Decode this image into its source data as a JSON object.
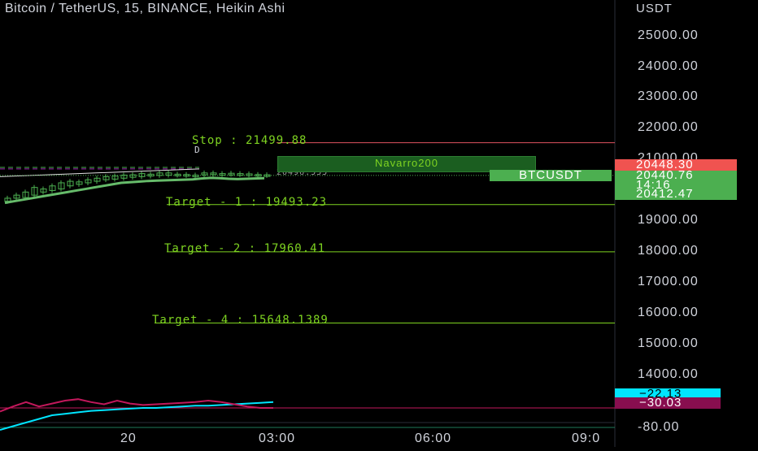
{
  "header": {
    "title": "Bitcoin / TetherUS, 15, BINANCE, Heikin Ashi",
    "currency": "USDT"
  },
  "price_axis_ticks": [
    "25000.00",
    "24000.00",
    "23000.00",
    "22000.00",
    "21000.00",
    "19000.00",
    "18000.00",
    "17000.00",
    "16000.00",
    "15000.00",
    "14000.00"
  ],
  "indicator_axis_ticks": [
    "-80.00"
  ],
  "time_axis_ticks": [
    "20",
    "03:00",
    "06:00",
    "09:0"
  ],
  "levels": {
    "stop": {
      "label": "Stop : 21499.88",
      "value": 21499.88,
      "color": "#e05260"
    },
    "target1": {
      "label": "Target - 1 : 19493.23",
      "value": 19493.23,
      "color": "#7ed321"
    },
    "target2": {
      "label": "Target - 2 : 17960.41",
      "value": 17960.41,
      "color": "#7ed321"
    },
    "target4": {
      "label": "Target - 4 : 15648.1389",
      "value": 15648.1389,
      "color": "#7ed321"
    },
    "entry_fragment": "20496.555",
    "d_marker": "D"
  },
  "overlays": {
    "navarro_box": "Navarro200",
    "symbol_tag": "BTCUSDT"
  },
  "price_tags": {
    "high": {
      "value": "20448.30",
      "color": "#f05350"
    },
    "last": {
      "value": "20440.76",
      "countdown": "14:16",
      "color": "#4caf50"
    },
    "low": {
      "value": "20412.47",
      "color": "#4caf50"
    }
  },
  "indicator_tags": {
    "cyan": {
      "value": "−22.13",
      "bg": "#00e5ff",
      "fg": "#000"
    },
    "maroon": {
      "value": "−30.03",
      "bg": "#880e4f",
      "fg": "#fff"
    }
  },
  "chart_data": {
    "type": "line",
    "title": "Bitcoin / TetherUS, 15, BINANCE, Heikin Ashi",
    "y_unit": "USDT",
    "ylim": [
      13600,
      25600
    ],
    "candles_ha": [
      {
        "o": 19600,
        "c": 19700
      },
      {
        "o": 19700,
        "c": 19800
      },
      {
        "o": 19720,
        "c": 19900
      },
      {
        "o": 19800,
        "c": 20050
      },
      {
        "o": 19900,
        "c": 20000
      },
      {
        "o": 19950,
        "c": 20100
      },
      {
        "o": 20000,
        "c": 20200
      },
      {
        "o": 20100,
        "c": 20250
      },
      {
        "o": 20150,
        "c": 20230
      },
      {
        "o": 20200,
        "c": 20300
      },
      {
        "o": 20250,
        "c": 20350
      },
      {
        "o": 20300,
        "c": 20400
      },
      {
        "o": 20320,
        "c": 20420
      },
      {
        "o": 20350,
        "c": 20450
      },
      {
        "o": 20380,
        "c": 20460
      },
      {
        "o": 20400,
        "c": 20500
      },
      {
        "o": 20420,
        "c": 20480
      },
      {
        "o": 20440,
        "c": 20520
      },
      {
        "o": 20450,
        "c": 20520
      },
      {
        "o": 20450,
        "c": 20480
      },
      {
        "o": 20440,
        "c": 20470
      },
      {
        "o": 20430,
        "c": 20450
      },
      {
        "o": 20460,
        "c": 20520
      },
      {
        "o": 20480,
        "c": 20520
      },
      {
        "o": 20470,
        "c": 20500
      },
      {
        "o": 20480,
        "c": 20510
      },
      {
        "o": 20470,
        "c": 20500
      },
      {
        "o": 20460,
        "c": 20490
      },
      {
        "o": 20450,
        "c": 20470
      },
      {
        "o": 20440,
        "c": 20460
      }
    ],
    "ma_line": [
      19550,
      19600,
      19650,
      19700,
      19750,
      19800,
      19850,
      19900,
      19950,
      20000,
      20050,
      20100,
      20150,
      20200,
      20220,
      20240,
      20260,
      20270,
      20280,
      20290,
      20300,
      20310,
      20340,
      20360,
      20350,
      20330,
      20320,
      20330,
      20340,
      20350
    ],
    "oscillator": {
      "series": [
        {
          "name": "cyan",
          "values": [
            -60,
            -55,
            -50,
            -45,
            -40,
            -38,
            -36,
            -34,
            -33,
            -32,
            -31,
            -30,
            -30,
            -29,
            -28,
            -27,
            -27,
            -26,
            -25,
            -24,
            -23,
            -22
          ]
        },
        {
          "name": "maroon",
          "values": [
            -35,
            -28,
            -22,
            -28,
            -24,
            -20,
            -18,
            -22,
            -25,
            -20,
            -24,
            -26,
            -25,
            -24,
            -23,
            -22,
            -20,
            -22,
            -25,
            -28,
            -30,
            -30
          ]
        }
      ]
    }
  }
}
